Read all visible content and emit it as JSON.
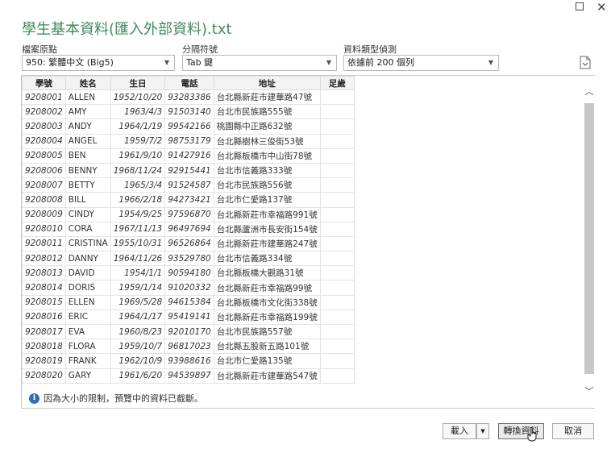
{
  "window": {
    "title": "學生基本資料(匯入外部資料).txt",
    "maximize_glyph": "☐",
    "close_glyph": "✕"
  },
  "options": {
    "file_origin": {
      "label": "檔案原點",
      "value": "950: 繁體中文 (Big5)"
    },
    "delimiter": {
      "label": "分隔符號",
      "value": "Tab 鍵"
    },
    "type_detection": {
      "label": "資料類型偵測",
      "value": "依據前 200 個列"
    },
    "dropdown_arrow": "▼"
  },
  "table": {
    "headers": [
      "學號",
      "姓名",
      "生日",
      "電話",
      "地址",
      "足歲"
    ],
    "rows": [
      [
        "9208001",
        "ALLEN",
        "1952/10/20",
        "93283386",
        "台北縣新莊市建華路47號",
        ""
      ],
      [
        "9208002",
        "AMY",
        "1963/4/3",
        "91503140",
        "台北市民族路555號",
        ""
      ],
      [
        "9208003",
        "ANDY",
        "1964/1/19",
        "99542166",
        "桃園縣中正路632號",
        ""
      ],
      [
        "9208004",
        "ANGEL",
        "1959/7/2",
        "98753179",
        "台北縣樹林三俊街53號",
        ""
      ],
      [
        "9208005",
        "BEN",
        "1961/9/10",
        "91427916",
        "台北縣板橋市中山街78號",
        ""
      ],
      [
        "9208006",
        "BENNY",
        "1968/11/24",
        "92915441",
        "台北市信義路333號",
        ""
      ],
      [
        "9208007",
        "BETTY",
        "1965/3/4",
        "91524587",
        "台北市民族路556號",
        ""
      ],
      [
        "9208008",
        "BILL",
        "1966/2/18",
        "94273421",
        "台北市仁愛路137號",
        ""
      ],
      [
        "9208009",
        "CINDY",
        "1954/9/25",
        "97596870",
        "台北縣新莊市幸福路991號",
        ""
      ],
      [
        "9208010",
        "CORA",
        "1967/11/13",
        "96497694",
        "台北縣蘆洲市長安街154號",
        ""
      ],
      [
        "9208011",
        "CRISTINA",
        "1955/10/31",
        "96526864",
        "台北縣新莊市建華路247號",
        ""
      ],
      [
        "9208012",
        "DANNY",
        "1964/11/26",
        "93529780",
        "台北市信義路334號",
        ""
      ],
      [
        "9208013",
        "DAVID",
        "1954/1/1",
        "90594180",
        "台北縣板橋大觀路31號",
        ""
      ],
      [
        "9208014",
        "DORIS",
        "1959/1/14",
        "91020332",
        "台北縣新莊市幸福路99號",
        ""
      ],
      [
        "9208015",
        "ELLEN",
        "1969/5/28",
        "94615384",
        "台北縣板橋市文化街338號",
        ""
      ],
      [
        "9208016",
        "ERIC",
        "1964/1/17",
        "95419141",
        "台北縣新莊市幸福路199號",
        ""
      ],
      [
        "9208017",
        "EVA",
        "1960/8/23",
        "92010170",
        "台北市民族路557號",
        ""
      ],
      [
        "9208018",
        "FLORA",
        "1959/10/7",
        "96817023",
        "台北縣五股新五路101號",
        ""
      ],
      [
        "9208019",
        "FRANK",
        "1962/10/9",
        "93988616",
        "台北市仁愛路135號",
        ""
      ],
      [
        "9208020",
        "GARY",
        "1961/6/20",
        "94539897",
        "台北縣新莊市建華路547號",
        ""
      ]
    ]
  },
  "notice": {
    "icon": "i",
    "text": "因為大小的限制，預覽中的資料已截斷。"
  },
  "scrollbar": {
    "up_glyph": "︿",
    "down_glyph": "﹀"
  },
  "footer": {
    "load_label": "載入",
    "load_dropdown_glyph": "▼",
    "transform_label": "轉換資料",
    "cancel_label": "取消"
  }
}
